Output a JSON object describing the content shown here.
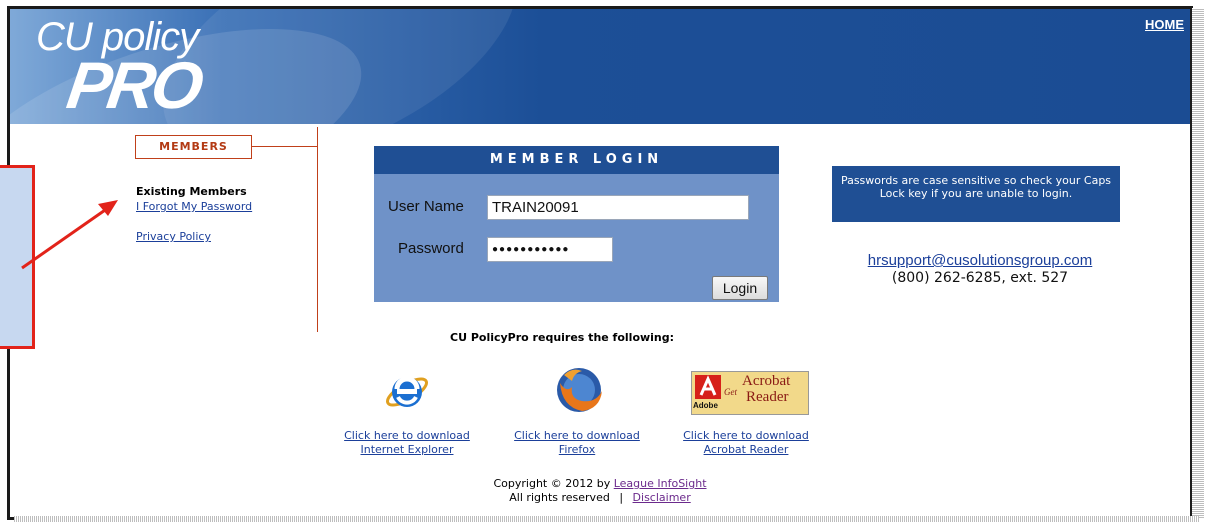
{
  "header": {
    "logo_top": "CU policy",
    "logo_bottom": "PRO",
    "home_link": "HOME"
  },
  "sidebar": {
    "members_label": "MEMBERS",
    "existing_members": "Existing Members",
    "forgot_password": "I Forgot My Password",
    "privacy_policy": "Privacy Policy"
  },
  "login": {
    "title": "MEMBER LOGIN",
    "username_label": "User Name",
    "username_value": "TRAIN20091",
    "password_label": "Password",
    "password_value": "●●●●●●●●●●●",
    "login_button": "Login"
  },
  "notice": {
    "text": "Passwords are case sensitive so check your Caps Lock key if you are unable to login.",
    "email": "hrsupport@cusolutionsgroup.com",
    "phone": "(800) 262-6285, ext. 527"
  },
  "requirements": {
    "heading": "CU PolicyPro requires the following:",
    "downloads": [
      {
        "line1": "Click here to download",
        "line2": "Internet Explorer",
        "icon": "internet-explorer-icon"
      },
      {
        "line1": "Click here to download",
        "line2": "Firefox",
        "icon": "firefox-icon"
      },
      {
        "line1": "Click here to download",
        "line2": "Acrobat Reader",
        "icon": "acrobat-reader-icon"
      }
    ],
    "adobe_badge": {
      "adobe": "Adobe",
      "get": "Get",
      "acrobat": "Acrobat",
      "reader": "Reader"
    }
  },
  "footer": {
    "copyright_prefix": "Copyright © 2012 by",
    "copyright_link": "League InfoSight",
    "rights": "All rights reserved",
    "separator": "|",
    "disclaimer": "Disclaimer"
  },
  "colors": {
    "brand_dark": "#1f4f94",
    "login_panel": "#6f92c8",
    "accent_red": "#c0401a",
    "callout_red": "#e2231a"
  }
}
